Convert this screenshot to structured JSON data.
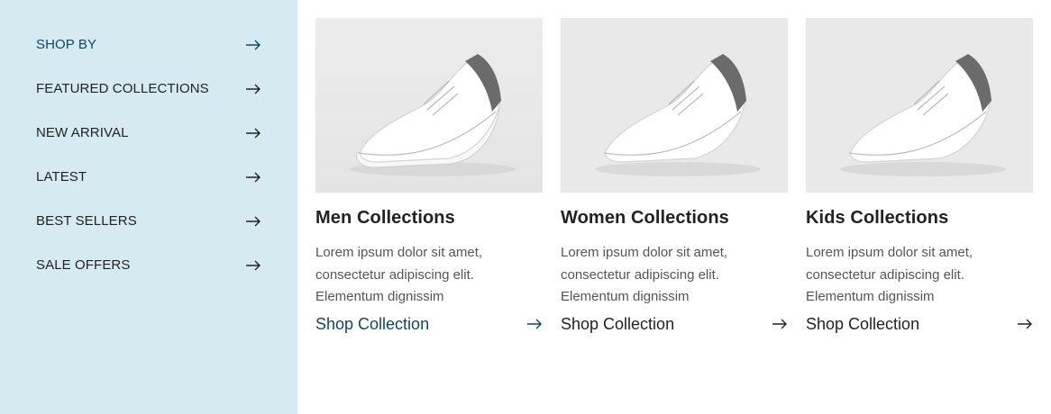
{
  "colors": {
    "sidebar_bg": "#d6eaf1",
    "accent": "#0d4a5c",
    "text": "#222222"
  },
  "sidebar": {
    "items": [
      {
        "label": "SHOP BY",
        "icon": "arrow-right-icon"
      },
      {
        "label": "FEATURED COLLECTIONS",
        "icon": "arrow-right-icon"
      },
      {
        "label": "NEW ARRIVAL",
        "icon": "arrow-right-icon"
      },
      {
        "label": "LATEST",
        "icon": "arrow-right-icon"
      },
      {
        "label": "BEST SELLERS",
        "icon": "arrow-right-icon"
      },
      {
        "label": "SALE OFFERS",
        "icon": "arrow-right-icon"
      }
    ]
  },
  "cards": [
    {
      "title": "Men Collections",
      "desc_lines": [
        "Lorem ipsum dolor sit amet,",
        "consectetur adipiscing elit.",
        "Elementum dignissim"
      ],
      "link": "Shop Collection",
      "image": "white-sneaker"
    },
    {
      "title": "Women Collections",
      "desc_lines": [
        "Lorem ipsum dolor sit amet,",
        "consectetur adipiscing elit.",
        "Elementum dignissim"
      ],
      "link": "Shop Collection",
      "image": "white-sneaker"
    },
    {
      "title": "Kids Collections",
      "desc_lines": [
        "Lorem ipsum dolor sit amet,",
        "consectetur adipiscing elit.",
        "Elementum dignissim"
      ],
      "link": "Shop Collection",
      "image": "white-sneaker"
    }
  ]
}
